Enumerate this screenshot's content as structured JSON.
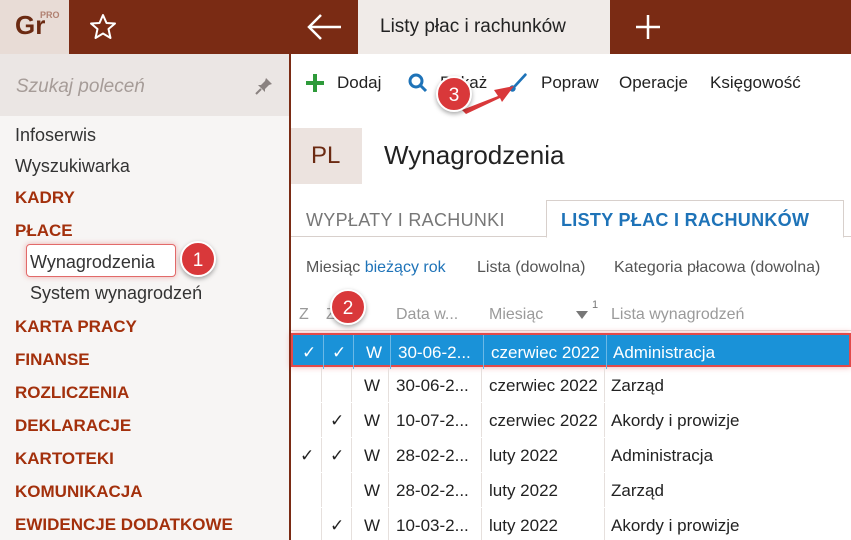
{
  "logo": {
    "text": "Gr",
    "superscript": "PRO"
  },
  "topbar": {
    "active_tab": "Listy płac i rachunków"
  },
  "sidebar": {
    "search_placeholder": "Szukaj poleceń",
    "items": [
      {
        "label": "Infoserwis",
        "kind": "item"
      },
      {
        "label": "Wyszukiwarka",
        "kind": "item"
      },
      {
        "label": "KADRY",
        "kind": "section"
      },
      {
        "label": "PŁACE",
        "kind": "section"
      },
      {
        "label": "Wynagrodzenia",
        "kind": "sub",
        "selected": true
      },
      {
        "label": "System wynagrodzeń",
        "kind": "sub"
      },
      {
        "label": "KARTA PRACY",
        "kind": "section"
      },
      {
        "label": "FINANSE",
        "kind": "section"
      },
      {
        "label": "ROZLICZENIA",
        "kind": "section"
      },
      {
        "label": "DEKLARACJE",
        "kind": "section"
      },
      {
        "label": "KARTOTEKI",
        "kind": "section"
      },
      {
        "label": "KOMUNIKACJA",
        "kind": "section"
      },
      {
        "label": "EWIDENCJE DODATKOWE",
        "kind": "section"
      }
    ]
  },
  "badges": {
    "b1": "1",
    "b2": "2",
    "b3": "3"
  },
  "toolbar": {
    "add": "Dodaj",
    "show": "Pokaż",
    "edit": "Popraw",
    "operations": "Operacje",
    "accounting": "Księgowość"
  },
  "header": {
    "icon_text": "PL",
    "title": "Wynagrodzenia"
  },
  "tabs": {
    "tab1": "WYPŁATY I RACHUNKI",
    "tab2": "LISTY PŁAC I RACHUNKÓW"
  },
  "filters": {
    "month_label": "Miesiąc",
    "month_value": "bieżący rok",
    "list": "Lista (dowolna)",
    "category": "Kategoria płacowa (dowolna)"
  },
  "table": {
    "columns": [
      "Z",
      "Z",
      "",
      "Data w...",
      "Miesiąc",
      "Lista wynagrodzeń"
    ],
    "sort_index": "1",
    "rows": [
      {
        "z1": "✓",
        "z2": "✓",
        "t": "W",
        "date": "30-06-2...",
        "month": "czerwiec 2022",
        "list": "Administracja",
        "selected": true
      },
      {
        "z1": "",
        "z2": "",
        "t": "W",
        "date": "30-06-2...",
        "month": "czerwiec 2022",
        "list": "Zarząd"
      },
      {
        "z1": "",
        "z2": "✓",
        "t": "W",
        "date": "10-07-2...",
        "month": "czerwiec 2022",
        "list": "Akordy i prowizje"
      },
      {
        "z1": "✓",
        "z2": "✓",
        "t": "W",
        "date": "28-02-2...",
        "month": "luty 2022",
        "list": "Administracja"
      },
      {
        "z1": "",
        "z2": "",
        "t": "W",
        "date": "28-02-2...",
        "month": "luty 2022",
        "list": "Zarząd"
      },
      {
        "z1": "",
        "z2": "✓",
        "t": "W",
        "date": "10-03-2...",
        "month": "luty 2022",
        "list": "Akordy i prowizje"
      }
    ]
  },
  "colors": {
    "brand": "#7a2b14",
    "accent": "#1e73b8",
    "selection": "#1a92d8",
    "badge": "#d9383a"
  }
}
